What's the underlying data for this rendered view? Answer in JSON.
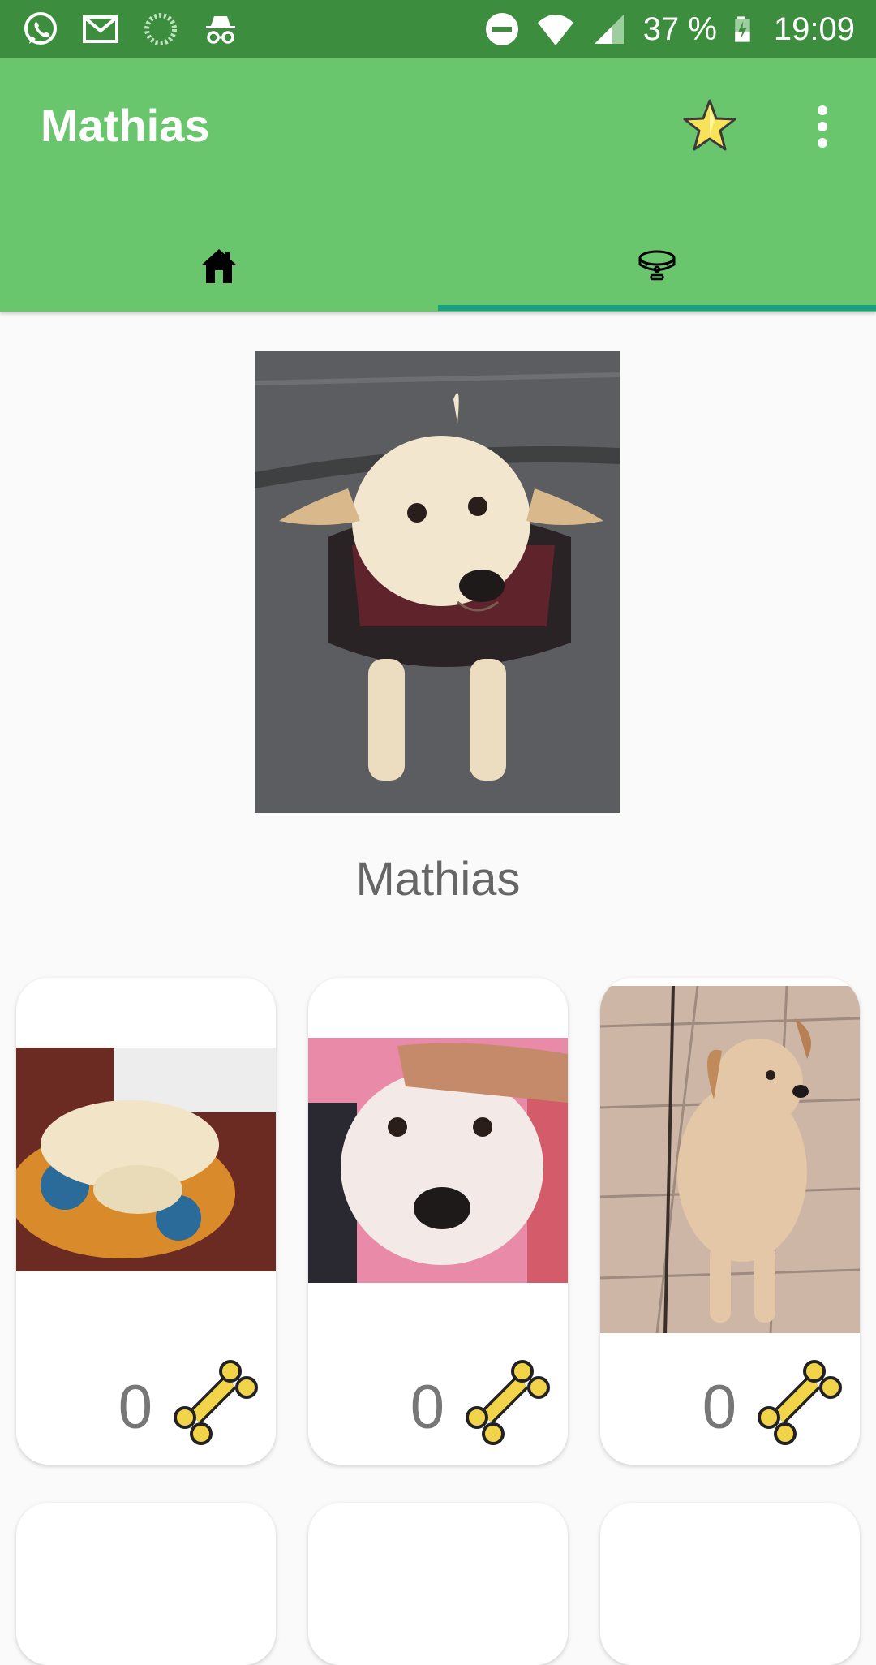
{
  "status_bar": {
    "battery": "37 %",
    "time": "19:09",
    "icons": [
      "whatsapp-icon",
      "gmail-icon",
      "sync-icon",
      "incognito-icon",
      "do-not-disturb-icon",
      "wifi-icon",
      "cell-signal-icon",
      "battery-charging-icon"
    ]
  },
  "app_bar": {
    "title": "Mathias",
    "actions": [
      "star-icon",
      "overflow-menu-icon"
    ]
  },
  "tabs": [
    {
      "icon": "home-icon",
      "selected": false
    },
    {
      "icon": "dog-collar-icon",
      "selected": true
    }
  ],
  "profile": {
    "name": "Mathias",
    "photo": "dog-portrait"
  },
  "gallery": [
    {
      "photo": "dog-sleeping-on-cushion",
      "likes": "0",
      "icon": "bone-icon"
    },
    {
      "photo": "dog-face-closeup",
      "likes": "0",
      "icon": "bone-icon"
    },
    {
      "photo": "dog-sitting-on-tiles",
      "likes": "0",
      "icon": "bone-icon"
    }
  ],
  "colors": {
    "status_bar": "#3c8d3e",
    "app_bar": "#69c66c",
    "tab_indicator": "#16a085",
    "bone": "#f1d44a",
    "star": "#f7e35a"
  }
}
